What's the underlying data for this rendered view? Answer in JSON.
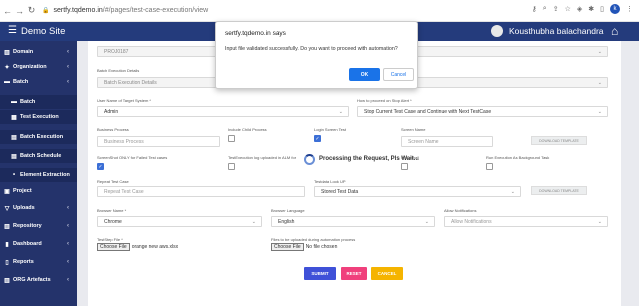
{
  "browser": {
    "url_host": "sertfy.tqdemo.in",
    "url_path": "/#/pages/test-case-execution/view"
  },
  "topbar": {
    "brand": "Demo Site",
    "user_name": "Kousthubha balachandra"
  },
  "sidebar": {
    "items": [
      {
        "label": "Domain",
        "icon": "globe-icon",
        "has_chevron": true
      },
      {
        "label": "Organization",
        "icon": "briefcase-icon",
        "has_chevron": true
      },
      {
        "label": "Batch",
        "icon": "folder-icon",
        "has_chevron": true
      },
      {
        "label": "Batch",
        "icon": "folder-icon",
        "sub": true
      },
      {
        "label": "Test Execution",
        "icon": "grid-icon",
        "sub": true
      },
      {
        "label": "Batch Execution",
        "icon": "document-icon",
        "sub": true
      },
      {
        "label": "Batch Schedule",
        "icon": "document-icon",
        "sub": true
      },
      {
        "label": "Element Extraction",
        "icon": "bullet-icon",
        "sub": true
      },
      {
        "label": "Project",
        "icon": "clipboard-icon",
        "has_chevron": false
      },
      {
        "label": "Uploads",
        "icon": "filter-icon",
        "has_chevron": true
      },
      {
        "label": "Repository",
        "icon": "chart-icon",
        "has_chevron": true
      },
      {
        "label": "Dashboard",
        "icon": "bar-chart-icon",
        "has_chevron": true
      },
      {
        "label": "Reports",
        "icon": "file-icon",
        "has_chevron": true
      },
      {
        "label": "ORG Artefacts",
        "icon": "chart-icon",
        "has_chevron": true
      }
    ]
  },
  "form": {
    "project_value": "PROJ0187",
    "execution_value_fragment": "ion",
    "batch_execution_details_label": "Batch Execution Details",
    "batch_execution_details_placeholder": "Batch Execution Details",
    "target_system_label": "User Name of Target System *",
    "target_system_value": "Admin",
    "proceed_label": "How to proceed on Stop Alert *",
    "proceed_value": "Stop Current Test Case and Continue with Next TestCase",
    "business_process_label": "Business Process",
    "business_process_placeholder": "Business Process",
    "include_child_label": "Include Child Process",
    "login_screen_label": "Login Screen Test",
    "screen_name_label": "Screen Name",
    "screen_name_placeholder": "Screen Name",
    "download_template_1": "DOWNLOAD TEMPLATE",
    "screenshot_label": "ScreenShot ONLY for Failed Test cases",
    "alm_label": "TestExecution log uploaded in ALM for",
    "email_label": "le in email",
    "background_label": "Run Execution As Background Task",
    "repeat_label": "Repeat Test Case",
    "repeat_placeholder": "Repeat Test Case",
    "testdata_label": "Testdata Look UP",
    "testdata_value": "Stored Test Data",
    "download_template_2": "DOWNLOAD TEMPLATE",
    "browser_label": "Browser Name *",
    "browser_value": "Chrome",
    "language_label": "Browser Language",
    "language_value": "English",
    "notifications_label": "Allow Notifications",
    "notifications_value": "Allow Notifications",
    "teststep_label": "TestStep File *",
    "choose_file": "Choose File",
    "teststep_file": "orange new aws.xlsx",
    "upload_label": "Files to be uploaded during automation process",
    "no_file": "No file chosen"
  },
  "actions": {
    "submit": "SUBMIT",
    "reset": "RESET",
    "cancel": "CANCEL"
  },
  "processing_text": "Processing the Request, Pls Wait...",
  "dialog": {
    "title": "sertfy.tqdemo.in says",
    "message": "Input file validated successfully. Do you want to proceed with automation?",
    "ok": "OK",
    "cancel": "Cancel"
  },
  "colors": {
    "topbar": "#243b7c",
    "sidebar": "#24336b",
    "submit": "#3f51d8",
    "reset": "#f0407c",
    "cancel": "#f5b400",
    "ok_button": "#1a73e8"
  }
}
